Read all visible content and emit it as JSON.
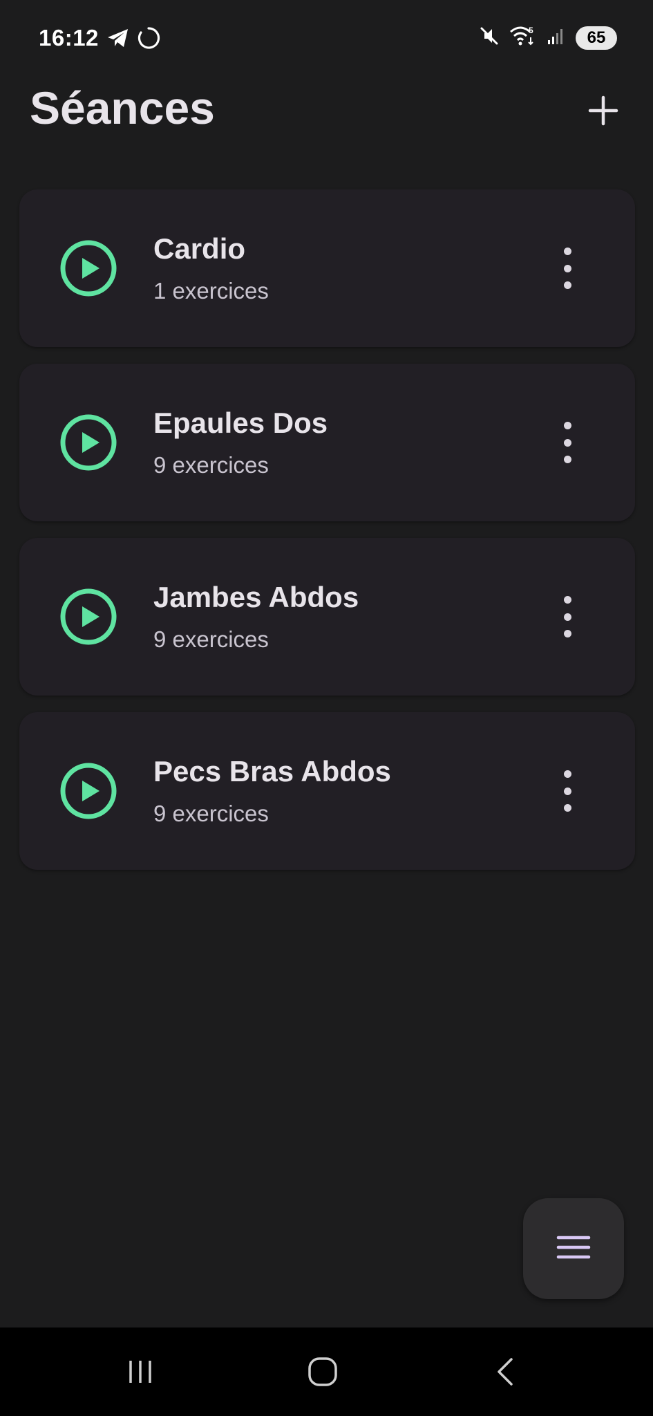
{
  "status_bar": {
    "time": "16:12",
    "battery": "65",
    "left_icons": [
      "telegram-icon",
      "loading-icon"
    ],
    "right_icons": [
      "mute-icon",
      "wifi-icon",
      "signal-icon"
    ]
  },
  "header": {
    "title": "Séances",
    "add_icon": "plus-icon"
  },
  "sessions": [
    {
      "name": "Cardio",
      "count": "1 exercices"
    },
    {
      "name": "Epaules Dos",
      "count": "9 exercices"
    },
    {
      "name": "Jambes Abdos",
      "count": "9 exercices"
    },
    {
      "name": "Pecs Bras Abdos",
      "count": "9 exercices"
    }
  ],
  "fab": {
    "icon": "menu-icon"
  },
  "nav": {
    "items": [
      "recents-icon",
      "home-icon",
      "back-icon"
    ]
  },
  "colors": {
    "background": "#1c1c1d",
    "card": "#221f25",
    "accent": "#5fe3a1",
    "text": "#e8e4ea",
    "fab_icon": "#d9c8f5"
  }
}
